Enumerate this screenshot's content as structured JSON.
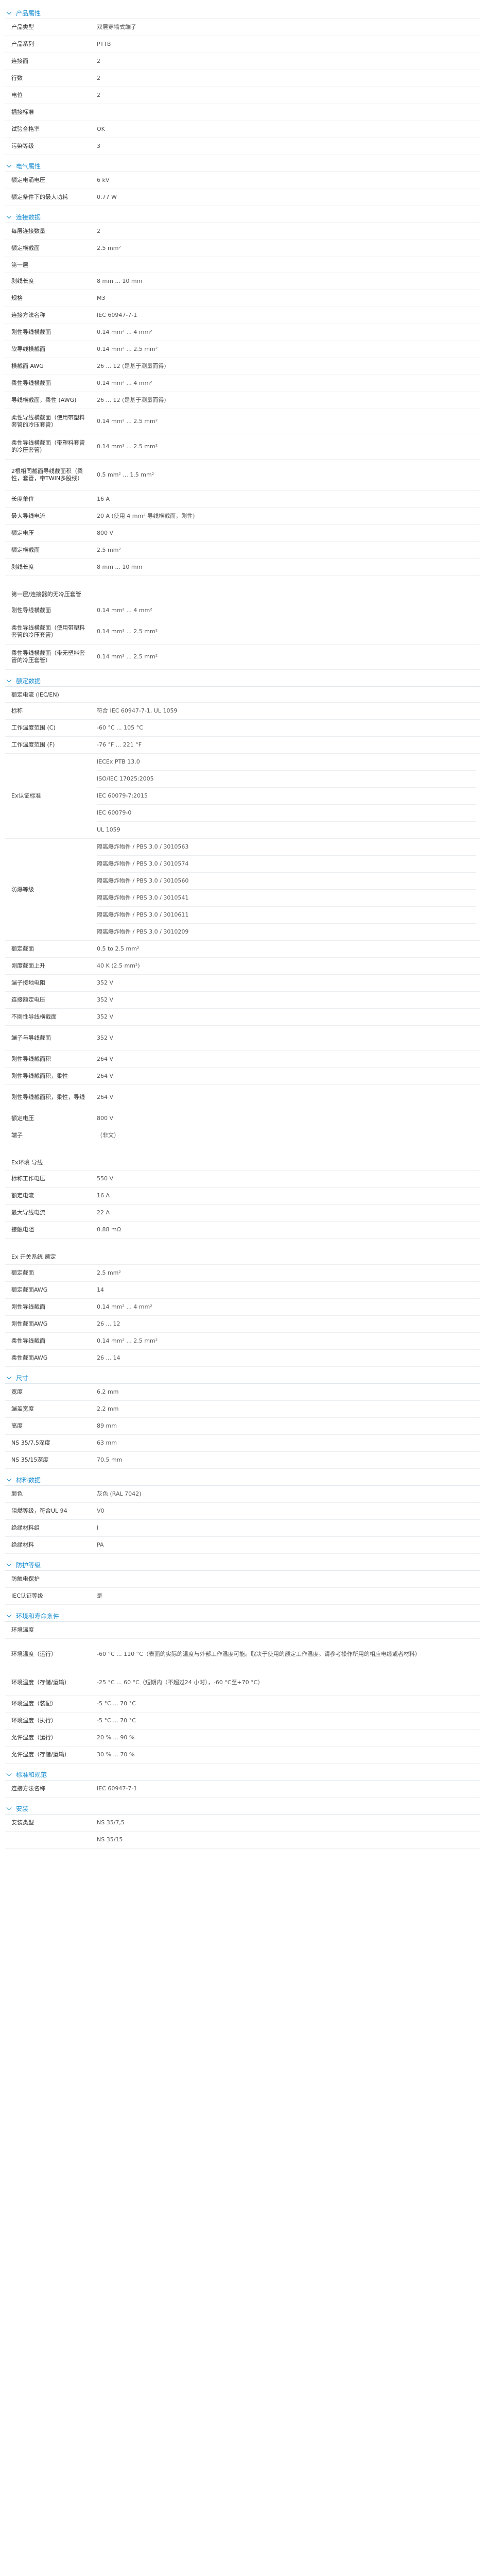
{
  "sections": {
    "general": "产品属性",
    "electrical": "电气属性",
    "connection": "连接数据",
    "ratings": "额定数据",
    "dimensions": "尺寸",
    "material": "材料数据",
    "environment": "环境和寿命条件",
    "standards": "标准和规范",
    "mounting": "安装"
  },
  "rows": {
    "r1": {
      "label": "产品类型",
      "value": "双层穿墙式端子"
    },
    "r2": {
      "label": "产品系列",
      "value": "PTTB"
    },
    "r3": {
      "label": "连接面",
      "value": "2"
    },
    "r4": {
      "label": "行数",
      "value": "2"
    },
    "r5": {
      "label": "电位",
      "value": "2"
    },
    "r6": {
      "label": "插接标准",
      "value": ""
    },
    "r7": {
      "label": "试验合格率",
      "value": "OK"
    },
    "r8": {
      "label": "污染等级",
      "value": "3"
    },
    "e1": {
      "label": "额定电涌电压",
      "value": "6 kV"
    },
    "e2": {
      "label": "额定条件下的最大功耗",
      "value": "0.77 W"
    },
    "c1": {
      "label": "每层连接数量",
      "value": "2"
    },
    "c2": {
      "label": "额定横截面",
      "value": "2.5 mm²"
    },
    "c_sub1": "第一层",
    "c3": {
      "label": "剥线长度",
      "value": "8 mm ... 10 mm"
    },
    "c4": {
      "label": "规格",
      "value": "M3"
    },
    "c5": {
      "label": "连接方法名称",
      "value": "IEC 60947-7-1"
    },
    "c6": {
      "label": "刚性导线横截面",
      "value": "0.14 mm² ... 4 mm²"
    },
    "c7": {
      "label": "软导线横截面",
      "value": "0.14 mm² ... 2.5 mm²"
    },
    "c8": {
      "label": "横截面 AWG",
      "value": "26 ... 12 (是基于测量而得)"
    },
    "c9": {
      "label": "柔性导线横截面",
      "value": "0.14 mm² ... 4 mm²"
    },
    "c10": {
      "label": "导线横截面，柔性 (AWG)",
      "value": "26 ... 12 (是基于测量而得)"
    },
    "c11": {
      "label": "柔性导线横截面（使用带塑料套管的冷压套管）",
      "value": "0.14 mm² ... 2.5 mm²"
    },
    "c12": {
      "label": "柔性导线横截面（带塑料套管的冷压套管）",
      "value": "0.14 mm² ... 2.5 mm²"
    },
    "c13": {
      "label": "2根相同截面导线截面积（柔性，套管，带TWIN多股线）",
      "value": "0.5 mm² ... 1.5 mm²"
    },
    "c14": {
      "label": "长度单位",
      "value": "16 A"
    },
    "c15": {
      "label": "最大导线电流",
      "value": "20 A (使用 4 mm² 导线横截面，刚性)"
    },
    "c16": {
      "label": "额定电压",
      "value": "800 V"
    },
    "c17": {
      "label": "额定横截面",
      "value": "2.5 mm²"
    },
    "c18": {
      "label": "剥线长度",
      "value": "8 mm ... 10 mm"
    },
    "c_sub2": "第一层/连接器的无冷压套管",
    "c19": {
      "label": "刚性导线横截面",
      "value": "0.14 mm² ... 4 mm²"
    },
    "c20": {
      "label": "柔性导线横截面（使用带塑料套管的冷压套管）",
      "value": "0.14 mm² ... 2.5 mm²"
    },
    "c21": {
      "label": "柔性导线横截面（带无塑料套管的冷压套管）",
      "value": "0.14 mm² ... 2.5 mm²"
    },
    "d_sub1": "额定电流 (IEC/EN)",
    "d1": {
      "label": "标称",
      "value": "符合 IEC 60947-7-1, UL 1059"
    },
    "d2": {
      "label": "工作温度范围 (C)",
      "value": "-60 °C ... 105 °C"
    },
    "d3": {
      "label": "工作温度范围 (F)",
      "value": "-76 °F ... 221 °F"
    },
    "d4": {
      "label": "Ex认证标准",
      "value": ""
    },
    "d4_items": [
      "IECEx PTB 13.0",
      "ISO/IEC 17025:2005",
      "IEC 60079-7:2015",
      "IEC 60079-0",
      "UL 1059"
    ],
    "d5": {
      "label": "防爆等级",
      "value": ""
    },
    "d5_items": [
      "隔离爆炸物件 / PBS 3.0 / 3010563",
      "隔离爆炸物件 / PBS 3.0 / 3010574",
      "隔离爆炸物件 / PBS 3.0 / 3010560",
      "隔离爆炸物件 / PBS 3.0 / 3010541",
      "隔离爆炸物件 / PBS 3.0 / 3010611",
      "隔离爆炸物件 / PBS 3.0 / 3010209"
    ],
    "d6": {
      "label": "额定截面",
      "value": "0.5 to 2.5 mm²"
    },
    "d7": {
      "label": "刚度截面上升",
      "value": "40 K (2.5 mm²)"
    },
    "d8": {
      "label": "端子接地电阻",
      "value": "352 V"
    },
    "d9": {
      "label": "连接额定电压",
      "value": "352 V"
    },
    "d10": {
      "label": "不刚性导线横截面",
      "value": "352 V"
    },
    "d11": {
      "label": "端子与导线截面",
      "value": "352 V"
    },
    "d12": {
      "label": "刚性导线截面积",
      "value": "264 V"
    },
    "d13": {
      "label": "刚性导线截面积，柔性",
      "value": "264 V"
    },
    "d14": {
      "label": "刚性导线截面积，柔性，导线",
      "value": "264 V"
    },
    "d15": {
      "label": "额定电压",
      "value": "800 V"
    },
    "d16": {
      "label": "端子",
      "value": "（非文）"
    },
    "d_sub2": "Ex环境 导线",
    "d17": {
      "label": "标称工作电压",
      "value": "550 V"
    },
    "d18": {
      "label": "额定电流",
      "value": "16 A"
    },
    "d19": {
      "label": "最大导线电流",
      "value": "22 A"
    },
    "d20": {
      "label": "接触电阻",
      "value": "0.88 mΩ"
    },
    "d_sub3": "Ex 开关系统 额定",
    "d21": {
      "label": "额定截面",
      "value": "2.5 mm²"
    },
    "d22": {
      "label": "额定截面AWG",
      "value": "14"
    },
    "d23": {
      "label": "刚性导线截面",
      "value": "0.14 mm² ... 4 mm²"
    },
    "d24": {
      "label": "刚性截面AWG",
      "value": "26 ... 12"
    },
    "d25": {
      "label": "柔性导线截面",
      "value": "0.14 mm² ... 2.5 mm²"
    },
    "d26": {
      "label": "柔性截面AWG",
      "value": "26 ... 14"
    },
    "s1": {
      "label": "宽度",
      "value": "6.2 mm"
    },
    "s2": {
      "label": "端盖宽度",
      "value": "2.2 mm"
    },
    "s3": {
      "label": "高度",
      "value": "89 mm"
    },
    "s4": {
      "label": "NS 35/7,5深度",
      "value": "63 mm"
    },
    "s5": {
      "label": "NS 35/15深度",
      "value": "70.5 mm"
    },
    "m1": {
      "label": "颜色",
      "value": "灰色 (RAL 7042)"
    },
    "m2": {
      "label": "阻燃等级，符合UL 94",
      "value": "V0"
    },
    "m3": {
      "label": "绝缘材料组",
      "value": "I"
    },
    "m4": {
      "label": "绝缘材料",
      "value": "PA"
    },
    "p_title": "防护等级",
    "p1": {
      "label": "防触电保护",
      "value": ""
    },
    "p2": {
      "label": "IEC认证等级",
      "value": "是"
    },
    "v1": {
      "label": "环境温度",
      "value": ""
    },
    "v2": {
      "label": "环境温度（运行）",
      "value": "-60 °C ... 110 °C（表面的实际的温度与外部工作温度可能。取决于使用的额定工作温度。请参考操作所用的相应电缆或者材料）"
    },
    "v3": {
      "label": "环境温度（存储/运输）",
      "value": "-25 °C ... 60 °C（短期内（不超过24 小时），-60 °C至+70 °C）"
    },
    "v4": {
      "label": "环境温度（装配）",
      "value": "-5 °C ... 70 °C"
    },
    "v5": {
      "label": "环境温度（执行）",
      "value": "-5 °C ... 70 °C"
    },
    "v6": {
      "label": "允许湿度（运行）",
      "value": "20 % ... 90 %"
    },
    "v7": {
      "label": "允许湿度（存储/运输）",
      "value": "30 % ... 70 %"
    },
    "st1": {
      "label": "连接方法名称",
      "value": "IEC 60947-7-1"
    },
    "mt1": {
      "label": "安装类型",
      "value": "NS 35/7,5"
    },
    "mt2": {
      "label": "",
      "value": "NS 35/15"
    }
  }
}
